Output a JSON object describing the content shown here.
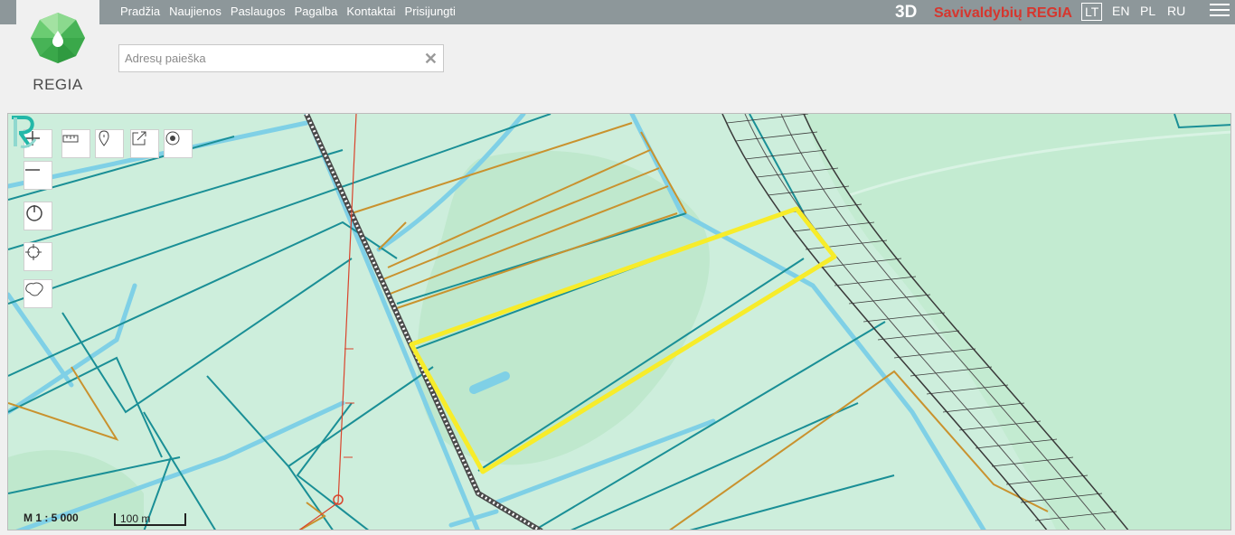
{
  "nav": {
    "items": [
      "Pradžia",
      "Naujienos",
      "Paslaugos",
      "Pagalba",
      "Kontaktai",
      "Prisijungti"
    ]
  },
  "logo": {
    "text": "REGIA"
  },
  "header": {
    "btn_3d": "3D",
    "brand": "Savivaldybių REGIA",
    "languages": [
      "LT",
      "EN",
      "PL",
      "RU"
    ],
    "active_language": "LT"
  },
  "search": {
    "placeholder": "Adresų paieška",
    "value": ""
  },
  "map": {
    "scale_label": "M 1 : 5 000",
    "scalebar_label": "100 m",
    "icons": {
      "zoom_in": "plus-icon",
      "zoom_out": "minus-icon",
      "measure": "ruler-icon",
      "marker": "marker-icon",
      "share": "share-icon",
      "locate": "target-icon",
      "power": "power-icon",
      "crosshair": "crosshair-icon",
      "country": "country-outline-icon"
    },
    "colors": {
      "background": "#cdeedc",
      "parcel_line": "#1a8f96",
      "road_line": "#7fd0e6",
      "highlight": "#f7ec2a",
      "orange_line": "#c9922e",
      "rail": "#4a4a4a",
      "power_line": "#d9442c"
    }
  }
}
